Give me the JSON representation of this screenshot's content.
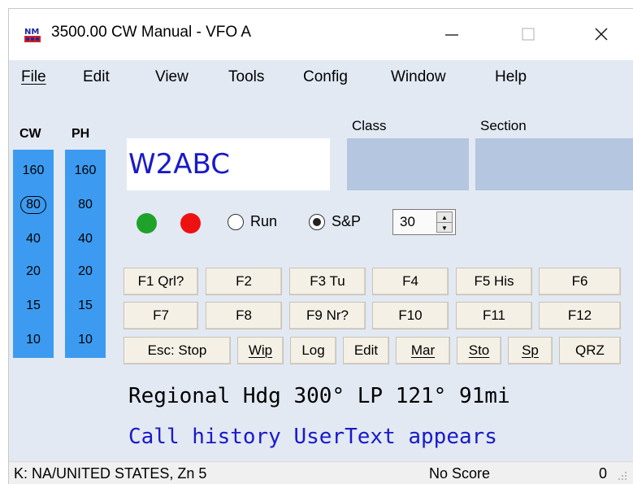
{
  "window": {
    "title": "3500.00 CW Manual - VFO A",
    "minimize_glyph": "—",
    "maximize_glyph": "☐",
    "close_glyph": "✕",
    "app_icon": "n1mm-logo-icon"
  },
  "menu": {
    "file": "File",
    "edit": "Edit",
    "view": "View",
    "tools": "Tools",
    "config": "Config",
    "window": "Window",
    "help": "Help"
  },
  "bands": {
    "cw_header": "CW",
    "ph_header": "PH",
    "cw": [
      "160",
      "80",
      "40",
      "20",
      "15",
      "10"
    ],
    "ph": [
      "160",
      "80",
      "40",
      "20",
      "15",
      "10"
    ],
    "selected_cw": "80"
  },
  "entry": {
    "callsign": "W2ABC",
    "class_label": "Class",
    "section_label": "Section",
    "class_value": "",
    "section_value": ""
  },
  "mode": {
    "run_label": "Run",
    "sp_label": "S&P",
    "selected": "S&P",
    "spin_value": "30"
  },
  "fkeys": {
    "row1": [
      "F1 Qrl?",
      "F2",
      "F3 Tu",
      "F4",
      "F5 His",
      "F6"
    ],
    "row2": [
      "F7",
      "F8",
      "F9 Nr?",
      "F10",
      "F11",
      "F12"
    ],
    "esc_stop": "Esc: Stop",
    "wipe": "Wip",
    "log": "Log",
    "edit": "Edit",
    "mark": "Mar",
    "store": "Sto",
    "spot": "Sp",
    "qrz": "QRZ"
  },
  "info": {
    "line1": "Regional Hdg 300° LP 121° 91mi",
    "line2": "Call history UserText appears"
  },
  "status": {
    "left": "K: NA/UNITED STATES, Zn 5",
    "middle": "No Score",
    "right": "0"
  },
  "colors": {
    "client_bg": "#e2e9f3",
    "band_column": "#3c9bf0",
    "callsign_text": "#1a1ac8",
    "field_bg": "#b4c6e0",
    "led_green": "#1fa22a",
    "led_red": "#ee1111"
  }
}
